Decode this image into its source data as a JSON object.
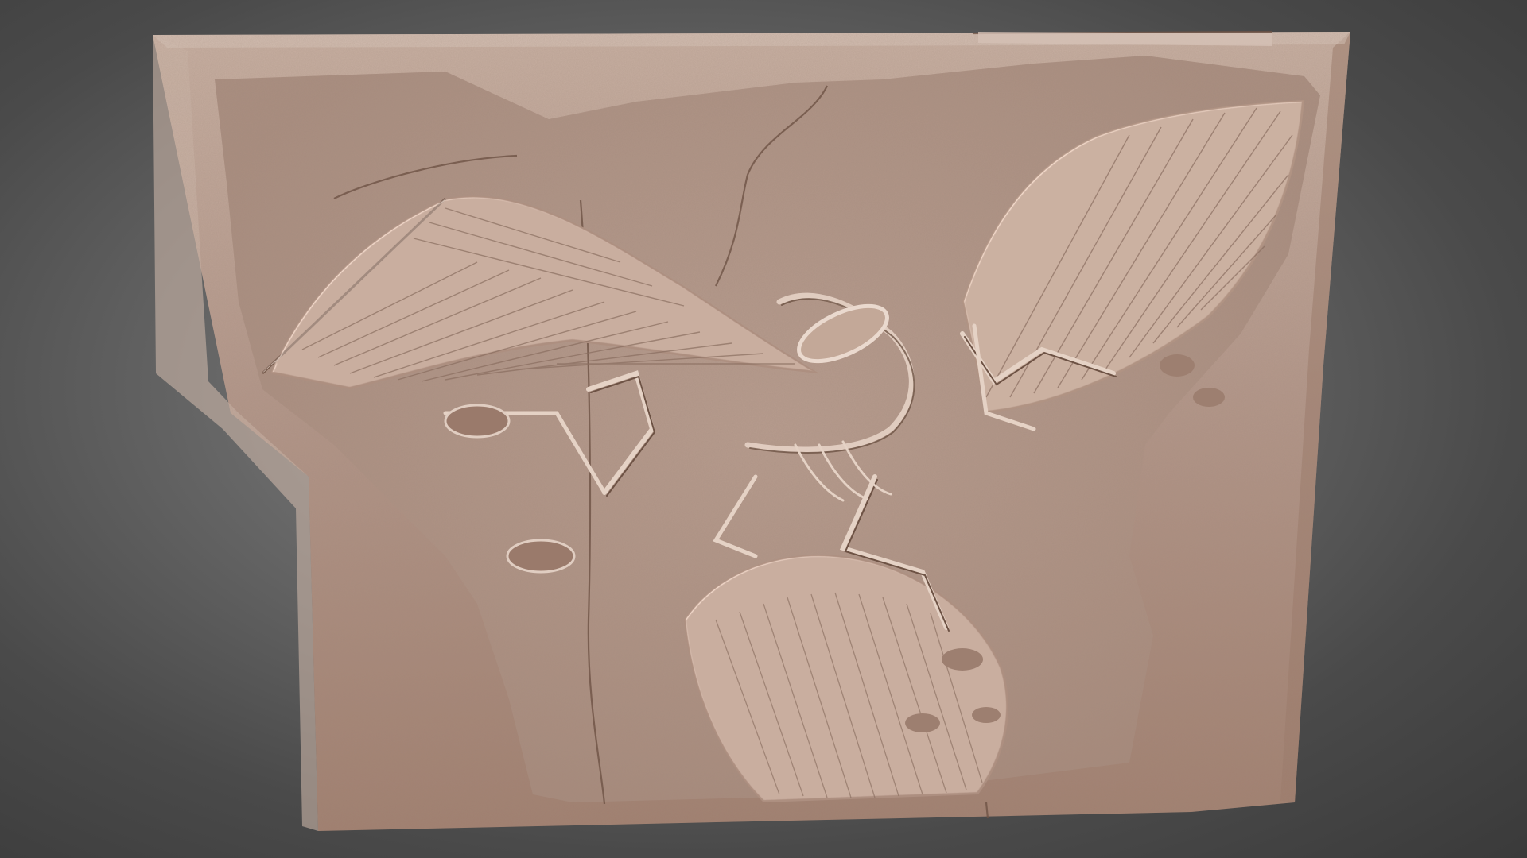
{
  "scene": {
    "subject": "3d-model-viewport",
    "colors": {
      "background_center": "#8a8a8a",
      "background_edge": "#3a3a3a",
      "slab_light": "#c9b2a4",
      "slab_mid": "#a88a7a",
      "slab_dark": "#7d6253",
      "relief_highlight": "#e6d6cb",
      "relief_shadow": "#5e4639"
    }
  }
}
